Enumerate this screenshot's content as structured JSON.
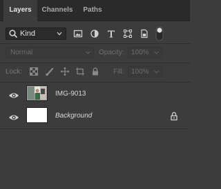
{
  "tabs": [
    {
      "label": "Layers",
      "active": true
    },
    {
      "label": "Channels",
      "active": false
    },
    {
      "label": "Paths",
      "active": false
    }
  ],
  "filter": {
    "kind_label": "Kind",
    "icons": [
      "pixel-layer-filter-icon",
      "adjustment-layer-filter-icon",
      "type-layer-filter-icon",
      "shape-layer-filter-icon",
      "smart-object-filter-icon",
      "filter-toggle-switch"
    ]
  },
  "blend": {
    "mode": "Normal",
    "opacity_label": "Opacity:",
    "opacity_value": "100%"
  },
  "lock": {
    "label": "Lock:",
    "fill_label": "Fill:",
    "fill_value": "100%",
    "icons": [
      "lock-transparent-pixels-icon",
      "lock-image-pixels-icon",
      "lock-position-icon",
      "lock-artboard-icon",
      "lock-all-icon"
    ]
  },
  "layers": [
    {
      "name": "IMG-9013",
      "visible": true,
      "italic": false,
      "locked": false
    },
    {
      "name": "Background",
      "visible": true,
      "italic": true,
      "locked": true
    }
  ],
  "colors": {
    "panel_bg": "#3c3c3c",
    "tab_bg": "#2a2a2a",
    "text": "#d6d6d6"
  }
}
